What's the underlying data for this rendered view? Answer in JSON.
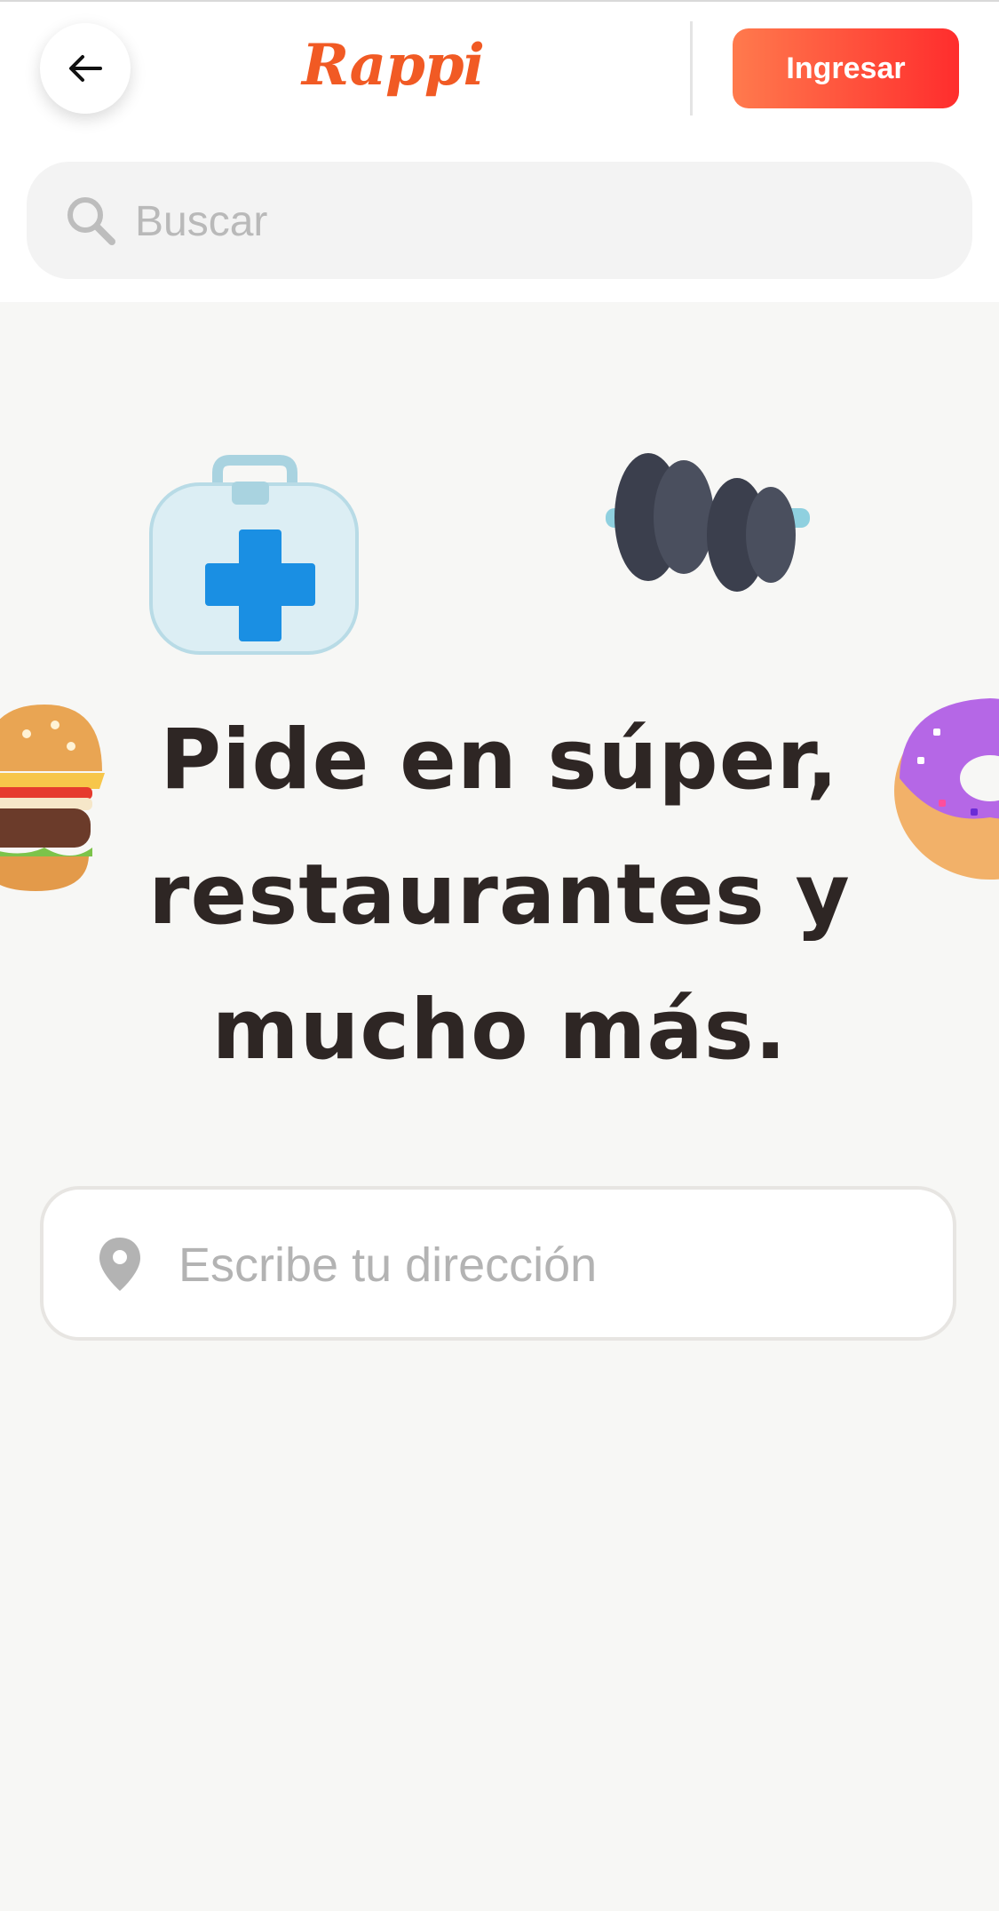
{
  "header": {
    "back_icon": "arrow-left-icon",
    "logo_text": "Rappi",
    "login_label": "Ingresar",
    "brand_color": "#f15a24"
  },
  "search": {
    "placeholder": "Buscar",
    "icon": "search-icon"
  },
  "hero": {
    "title_lines": [
      "Pide en súper,",
      "restaurantes y",
      "mucho más."
    ],
    "decorations": [
      "first-aid-kit-icon",
      "dumbbell-icon",
      "burger-icon",
      "donut-icon"
    ]
  },
  "address": {
    "placeholder": "Escribe tu dirección",
    "icon": "location-pin-icon"
  }
}
